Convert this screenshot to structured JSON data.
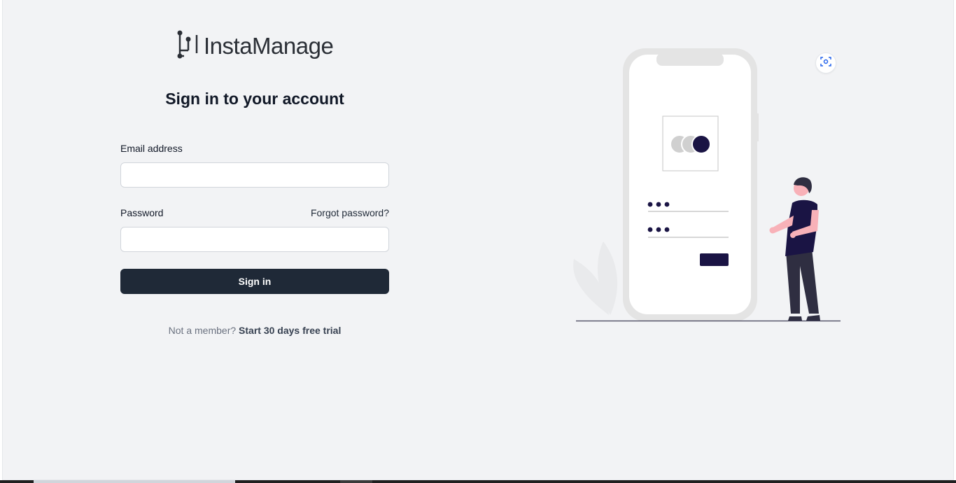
{
  "logo": {
    "text": "InstaManage"
  },
  "heading": "Sign in to your account",
  "form": {
    "email_label": "Email address",
    "email_value": "",
    "password_label": "Password",
    "password_value": "",
    "forgot_link": "Forgot password?",
    "submit_label": "Sign in"
  },
  "footer": {
    "prompt": "Not a member?",
    "trial_link": "Start 30 days free trial"
  },
  "icons": {
    "logo": "circuit-logo-icon",
    "scan": "screen-capture-icon"
  },
  "colors": {
    "page_bg": "#f2f3f5",
    "primary_button": "#1f2937",
    "illustration_accent": "#1a1444",
    "skin": "#f8b1b8"
  }
}
